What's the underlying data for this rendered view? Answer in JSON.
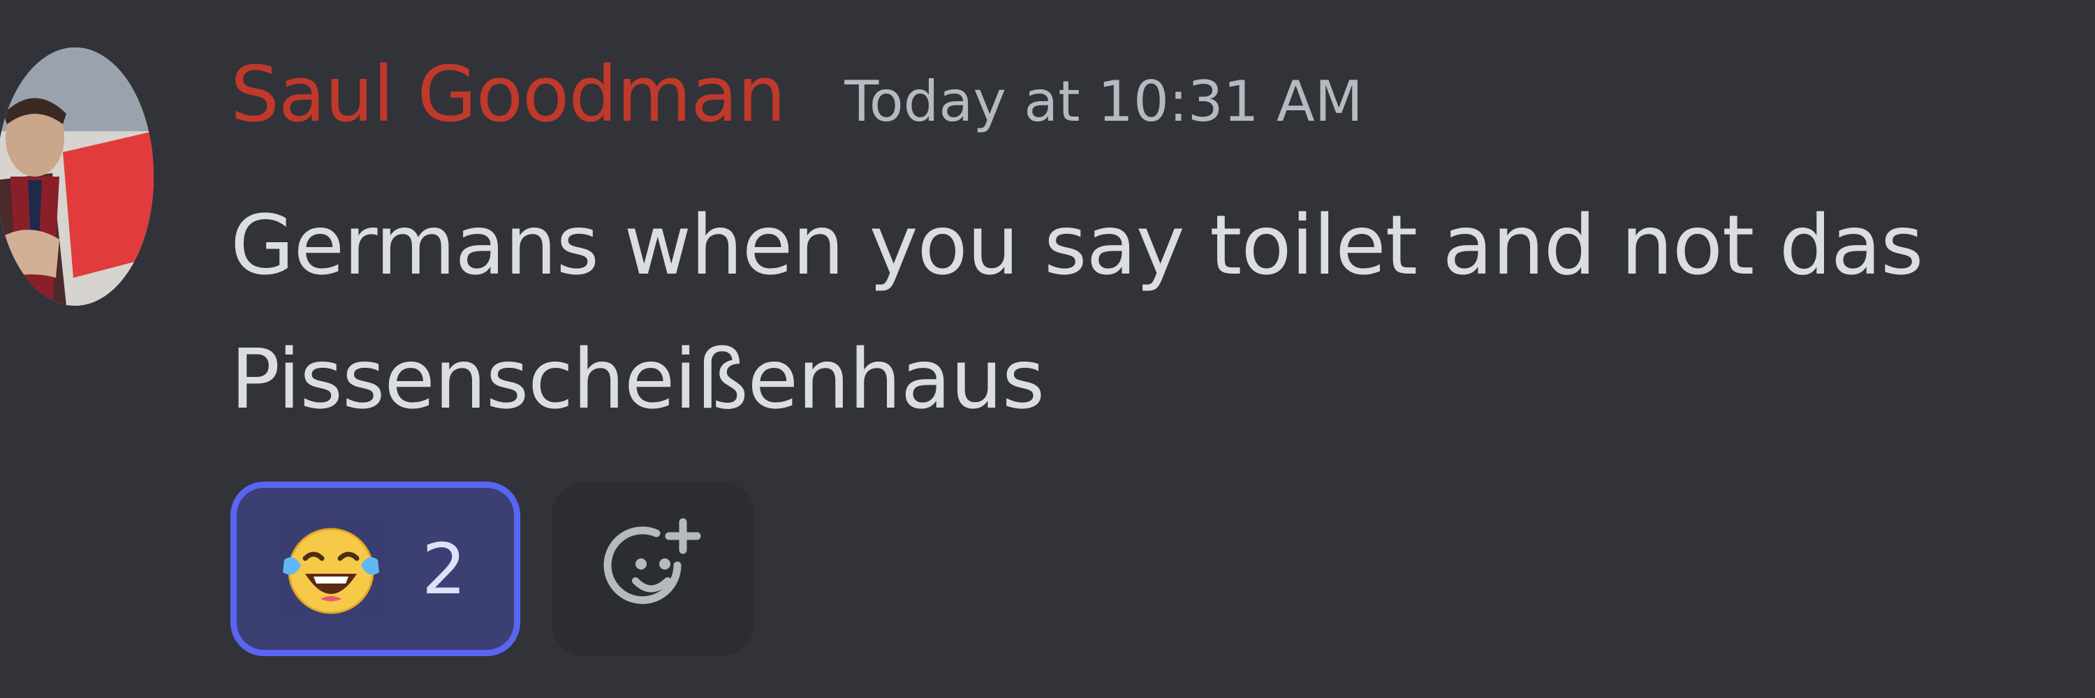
{
  "message": {
    "author": "Saul Goodman",
    "timestamp": "Today at 10:31 AM",
    "text_line_1": "Germans when you say toilet and not das",
    "text_line_2": "Pissenscheißenhaus"
  },
  "reactions": [
    {
      "emoji": "tears-of-joy-emoji",
      "count": "2",
      "active": true
    }
  ],
  "add_reaction": {
    "icon": "smiley-plus-icon"
  },
  "colors": {
    "background": "#313338",
    "username": "#c0392b",
    "timestamp": "#b5bac1",
    "text": "#dbdee1",
    "reaction_active_bg": "#3b3f72",
    "reaction_active_border": "#5865f2",
    "add_reaction_bg": "#2b2d31"
  }
}
